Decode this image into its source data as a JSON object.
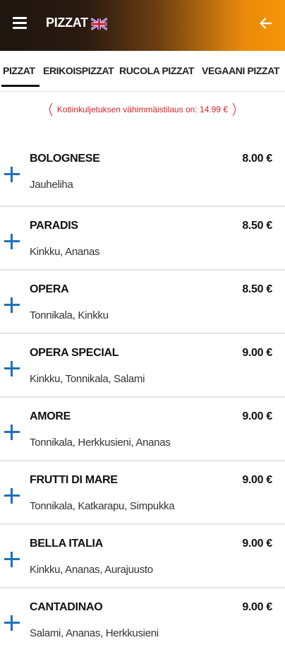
{
  "header": {
    "title": "PIZZAT"
  },
  "tabs": [
    {
      "label": "PIZZAT"
    },
    {
      "label": "ERIKOISPIZZAT"
    },
    {
      "label": "RUCOLA PIZZAT"
    },
    {
      "label": "VEGAANI PIZZAT"
    }
  ],
  "notice": "Kotiinkuljetuksen vähimmäistilaus on: 14.99 €",
  "items": [
    {
      "name": "BOLOGNESE",
      "desc": "Jauheliha",
      "price": "8.00 €"
    },
    {
      "name": "PARADIS",
      "desc": "Kinkku, Ananas",
      "price": "8.50 €"
    },
    {
      "name": "OPERA",
      "desc": "Tonnikala, Kinkku",
      "price": "8.50 €"
    },
    {
      "name": "OPERA SPECIAL",
      "desc": "Kinkku, Tonnikala, Salami",
      "price": "9.00 €"
    },
    {
      "name": "AMORE",
      "desc": "Tonnikala, Herkkusieni, Ananas",
      "price": "9.00 €"
    },
    {
      "name": "FRUTTI DI MARE",
      "desc": "Tonnikala, Katkarapu, Simpukka",
      "price": "9.00 €"
    },
    {
      "name": "BELLA ITALIA",
      "desc": "Kinkku, Ananas, Aurajuusto",
      "price": "9.00 €"
    },
    {
      "name": "CANTADINAO",
      "desc": "Salami, Ananas, Herkkusieni",
      "price": "9.00 €"
    }
  ],
  "colors": {
    "accent": "#1f6fba",
    "notice": "#d8222a",
    "header_end": "#f69505"
  },
  "icons": {
    "menu": "hamburger-menu-icon",
    "flag": "uk-flag-icon",
    "back": "arrow-back-icon",
    "add": "plus-icon"
  }
}
